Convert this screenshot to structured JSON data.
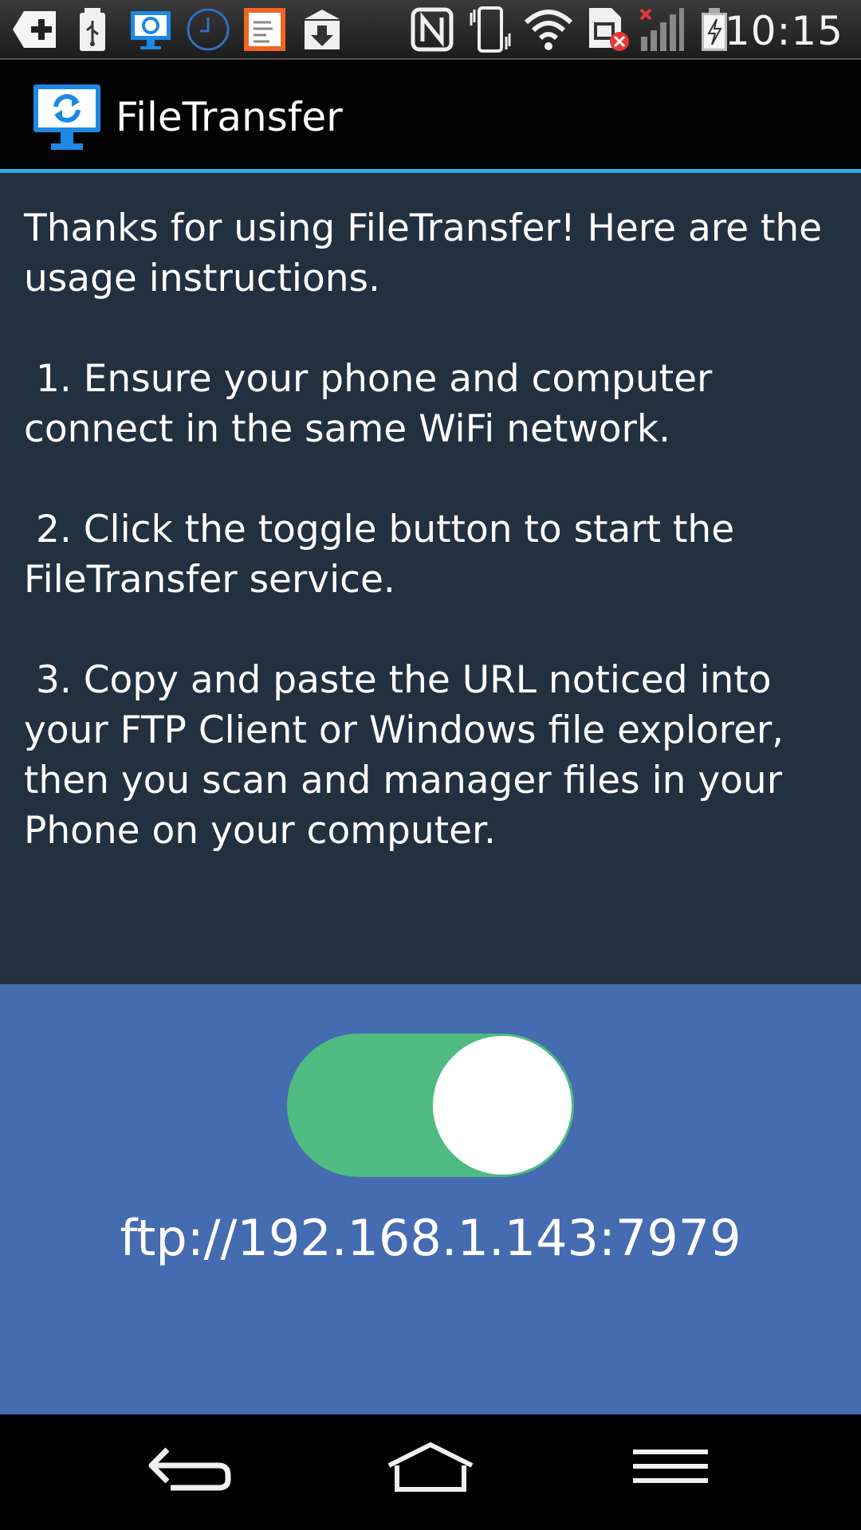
{
  "status_bar": {
    "time": "10:15",
    "icons": [
      "add-icon",
      "usb-icon",
      "filetransfer-notification-icon",
      "clock-icon",
      "notes-icon",
      "download-icon",
      "nfc-icon",
      "vibrate-icon",
      "wifi-icon",
      "sim-error-icon",
      "signal-icon",
      "battery-charging-icon"
    ],
    "accent_color": "#2ea8de"
  },
  "app_bar": {
    "title": "FileTransfer",
    "logo_icon": "filetransfer-logo-icon"
  },
  "instructions": {
    "intro": "Thanks for using FileTransfer! Here are the usage instructions.",
    "step1": " 1. Ensure your phone and computer connect in the same WiFi network.",
    "step2": " 2. Click the toggle button to start the FileTransfer service.",
    "step3": " 3. Copy and paste the URL noticed into your FTP Client or Windows file explorer, then you scan and manager files in your Phone on your computer."
  },
  "control": {
    "toggle_state": "on",
    "toggle_color": "#4fbb80",
    "ftp_url": "ftp://192.168.1.143:7979"
  },
  "colors": {
    "instructions_bg": "#233040",
    "control_bg": "#456bb1"
  },
  "nav_bar": {
    "buttons": [
      "back-icon",
      "home-icon",
      "menu-icon"
    ]
  }
}
